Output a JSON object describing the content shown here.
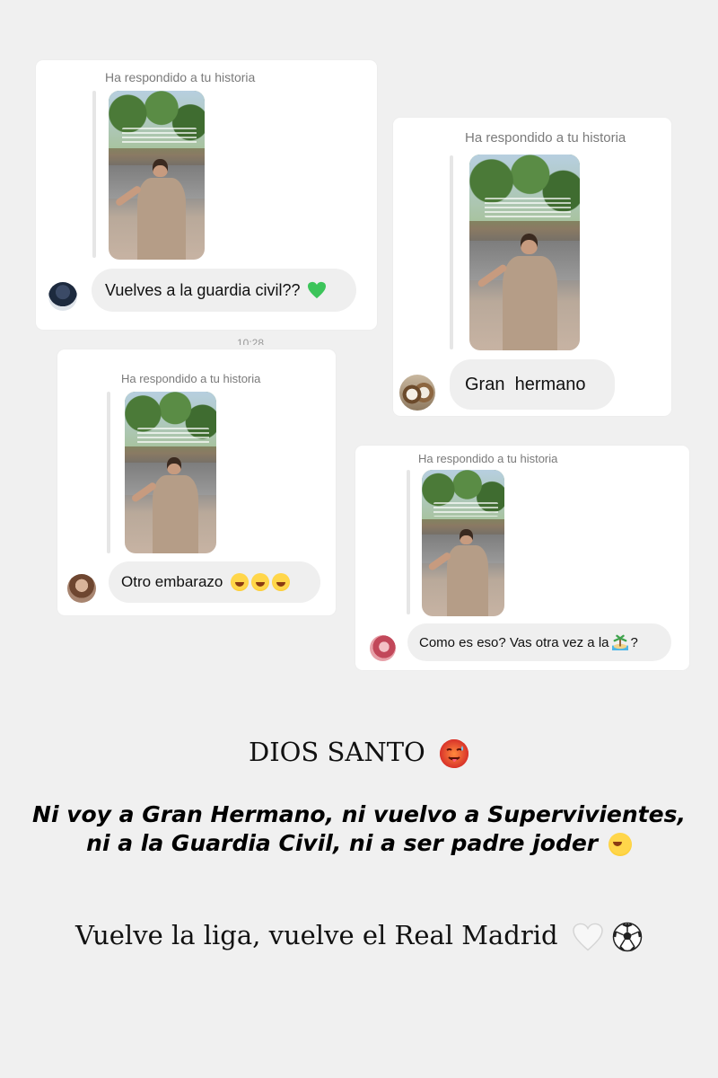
{
  "cards": [
    {
      "header": "Ha respondido a tu historia",
      "reply": "Vuelves a la guardia civil??",
      "reply_emoji": "green-heart-icon"
    },
    {
      "header": "Ha respondido a tu historia",
      "reply": "Gran  hermano"
    },
    {
      "header": "Ha respondido a tu historia",
      "reply": "Otro embarazo",
      "reply_emoji": "rolling-laughing-icon",
      "timestamp_fragment": "10:28"
    },
    {
      "header": "Ha respondido a tu historia",
      "reply_before": "Como es eso? Vas otra vez a la",
      "reply_emoji": "desert-island-icon",
      "reply_after": "?"
    }
  ],
  "captions": {
    "line1": "DIOS SANTO",
    "line1_emoji": "hot-face-icon",
    "line2a": "Ni voy a Gran Hermano, ni vuelvo a Supervivientes,",
    "line2b": "ni a la Guardia Civil, ni a ser padre joder",
    "line2_emoji": "rolling-laughing-icon",
    "line3": "Vuelve la liga, vuelve el Real Madrid",
    "line3_emojis": [
      "white-heart-icon",
      "soccer-ball-icon"
    ]
  },
  "colors": {
    "background": "#f0f0f0",
    "card": "#ffffff",
    "bubble": "#efefef",
    "header_text": "#7a7a7a",
    "green_heart": "#3cc45a"
  }
}
